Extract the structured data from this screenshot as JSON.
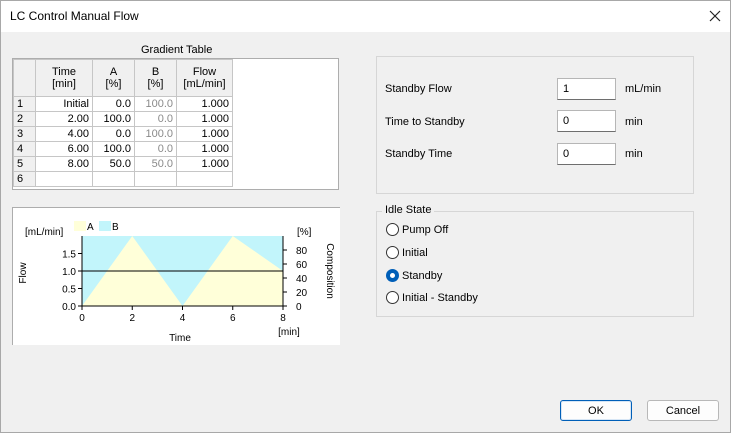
{
  "window": {
    "title": "LC Control Manual Flow",
    "close_icon": "close-icon"
  },
  "gradient_table": {
    "title": "Gradient Table",
    "headers": [
      "",
      "Time\n[min]",
      "A\n[%]",
      "B\n[%]",
      "Flow\n[mL/min]"
    ],
    "rows": [
      {
        "n": "1",
        "time": "Initial",
        "a": "0.0",
        "b": "100.0",
        "flow": "1.000"
      },
      {
        "n": "2",
        "time": "2.00",
        "a": "100.0",
        "b": "0.0",
        "flow": "1.000"
      },
      {
        "n": "3",
        "time": "4.00",
        "a": "0.0",
        "b": "100.0",
        "flow": "1.000"
      },
      {
        "n": "4",
        "time": "6.00",
        "a": "100.0",
        "b": "0.0",
        "flow": "1.000"
      },
      {
        "n": "5",
        "time": "8.00",
        "a": "50.0",
        "b": "50.0",
        "flow": "1.000"
      },
      {
        "n": "6",
        "time": "",
        "a": "",
        "b": "",
        "flow": ""
      }
    ]
  },
  "chart_data": {
    "type": "area",
    "legend": [
      "A",
      "B"
    ],
    "colors": {
      "A": "#ffffd9",
      "B": "#c2f5fb",
      "flow": "#000000"
    },
    "x": [
      0,
      2,
      4,
      6,
      8
    ],
    "xticks": [
      "0",
      "2",
      "4",
      "6",
      "8"
    ],
    "xlabel": "Time",
    "xunit": "[min]",
    "flow_ylabel": "Flow",
    "flow_unit": "[mL/min]",
    "flow_ylim": [
      0,
      2
    ],
    "flow_ticks": [
      "0.0",
      "0.5",
      "1.0",
      "1.5"
    ],
    "composition_ylabel": "Composition",
    "composition_unit": "[%]",
    "composition_ylim": [
      0,
      100
    ],
    "composition_ticks": [
      "0",
      "20",
      "40",
      "60",
      "80"
    ],
    "series": [
      {
        "name": "A",
        "values": [
          0,
          100,
          0,
          100,
          50
        ]
      },
      {
        "name": "B",
        "values": [
          100,
          0,
          100,
          0,
          50
        ]
      }
    ],
    "flow_values": [
      1,
      1,
      1,
      1,
      1
    ]
  },
  "standby": {
    "flow_label": "Standby Flow",
    "flow_value": "1",
    "flow_unit": "mL/min",
    "time_to_label": "Time to Standby",
    "time_to_value": "0",
    "time_to_unit": "min",
    "time_label": "Standby Time",
    "time_value": "0",
    "time_unit": "min"
  },
  "idle_state": {
    "legend": "Idle State",
    "options": [
      "Pump Off",
      "Initial",
      "Standby",
      "Initial - Standby"
    ],
    "selected": "Standby"
  },
  "buttons": {
    "ok": "OK",
    "cancel": "Cancel"
  }
}
